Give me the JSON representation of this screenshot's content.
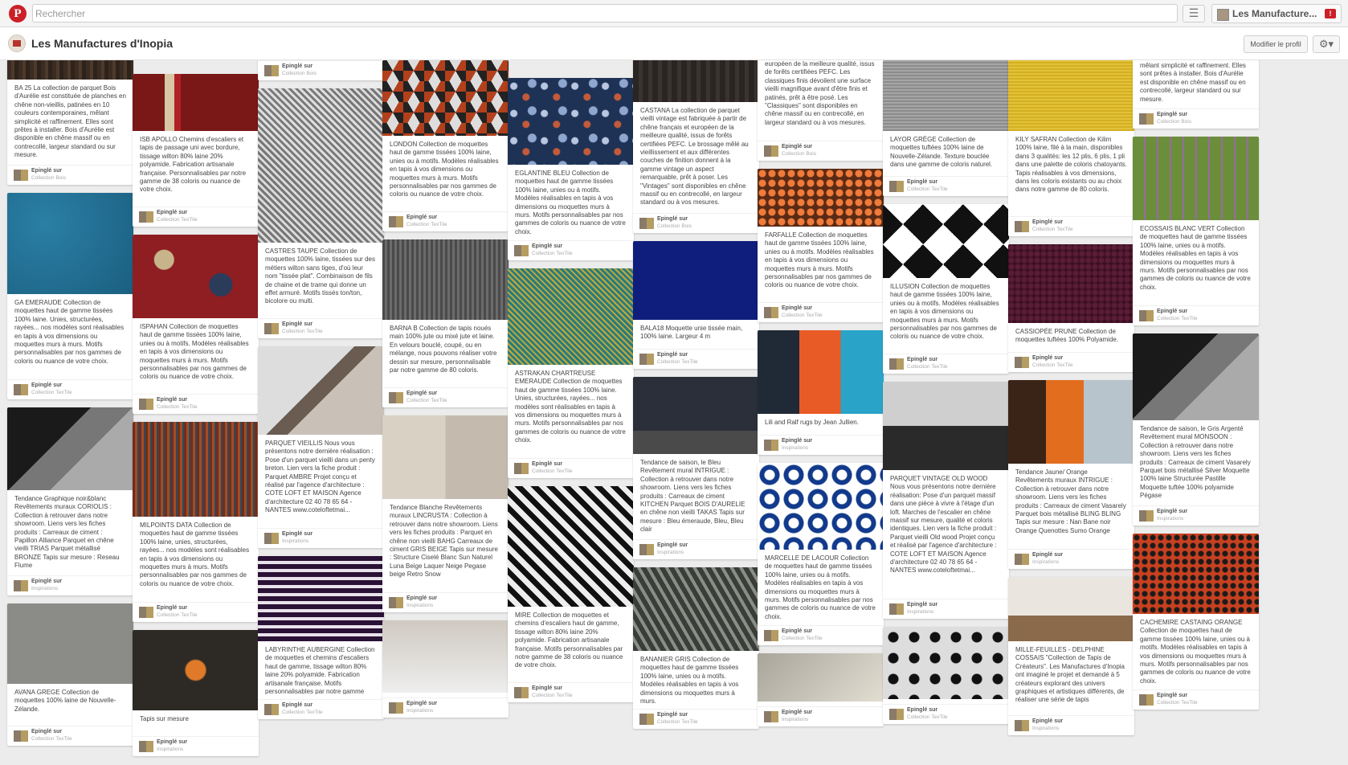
{
  "topbar": {
    "search_placeholder": "Rechercher",
    "logo_letter": "P",
    "user_name": "Les Manufacture...",
    "notif_badge": "!"
  },
  "profile": {
    "name": "Les Manufactures d'Inopia",
    "edit_button": "Modifier le profil"
  },
  "columns": [
    {
      "pins": [
        {
          "pattern": "p-wood",
          "img_h": 38,
          "desc": "BA 25 La collection de parquet Bois d'Aurélie est constituée de planches en chêne non-vieillis, patinées en 10 couleurs contemporaines, mêlant simplicité et raffinement. Elles sont prêtes à installer. Bois d'Aurélie est disponible en chêne massif ou en contrecollé, largeur standard ou sur mesure.",
          "desc_h": 94,
          "src1": "Epinglé sur",
          "src2": "Collection Bois"
        },
        {
          "pattern": "p-blue",
          "img_h": 126,
          "desc": "GA EMERAUDE Collection de moquettes haut de gamme tissées 100% laine. Unies, structurées, rayées... nos modèles sont réalisables en tapis à vos dimensions ou moquettes murs à murs. Motifs personnalisables par nos gammes de coloris ou nuance de votre choix.",
          "desc_h": 94,
          "src1": "Epinglé sur",
          "src2": "Collection TexTile"
        },
        {
          "pattern": "p-mood-black",
          "img_h": 103,
          "desc": "Tendance Graphique noir&blanc Revêtements muraux CORIOLIS : Collection à retrouver dans notre showroom. Liens vers les fiches produits : Carreaux de ciment : Papillon Alliance Parquet en chêne vieilli TRIAS Parquet métallisé BRONZE Tapis sur mesure : Reseau Flume",
          "desc_h": 94,
          "src1": "Epinglé sur",
          "src2": "Inspirations"
        },
        {
          "pattern": "p-greystone",
          "img_h": 100,
          "desc": "AVANA GREGE Collection de moquettes 100% laine de Nouvelle-Zélande.",
          "desc_h": 40,
          "src1": "Epinglé sur",
          "src2": "Collection TexTile"
        }
      ]
    },
    {
      "pins": [
        {
          "pattern": "p-red-stripe",
          "img_h": 71,
          "desc": "ISB APOLLO Chemins d'escaliers et tapis de passage uni avec bordure, tissage wilton 80% laine 20% polyamide. Fabrication artisanale française. Personnalisables par notre gamme de 38 coloris ou nuance de votre choix.",
          "desc_h": 82,
          "src1": "Epinglé sur",
          "src2": "Collection TexTile"
        },
        {
          "pattern": "p-paisley",
          "img_h": 104,
          "desc": "ISPAHAN Collection de moquettes haut de gamme tissées 100% laine, unies ou à motifs. Modèles réalisables en tapis à vos dimensions ou moquettes murs à murs. Motifs personnalisables par nos gammes de coloris ou nuance de votre choix.",
          "desc_h": 82,
          "src1": "Epinglé sur",
          "src2": "Collection TexTile"
        },
        {
          "pattern": "p-multistripe",
          "img_h": 118,
          "desc": "MILPOINTS DATA Collection de moquettes haut de gamme tissées 100% laine, unies, structurées, rayées... nos modèles sont réalisables en tapis à vos dimensions ou moquettes murs à murs. Motifs personnalisables par nos gammes de coloris ou nuance de votre choix.",
          "desc_h": 94,
          "src1": "Epinglé sur",
          "src2": "Collection TexTile"
        },
        {
          "pattern": "p-rug-orange",
          "img_h": 100,
          "desc": "Tapis sur mesure",
          "desc_h": 20,
          "src1": "Epinglé sur",
          "src2": "Inspirations"
        }
      ]
    },
    {
      "pins": [
        {
          "pattern": "p-beige",
          "img_h": 0,
          "desc": "",
          "desc_h": 0,
          "src1": "Epinglé sur",
          "src2": "Collection Bois"
        },
        {
          "pattern": "p-herring",
          "img_h": 192,
          "desc": "CASTRES TAUPE Collection de moquettes 100% laine, tissées sur des métiers wilton sans tiges, d'où leur nom \"tissée plat\". Combinaison de fils de chaine et de trame qui donne un effet armuré. Motifs tissés ton/ton, bicolore ou multi.",
          "desc_h": 82,
          "src1": "Epinglé sur",
          "src2": "Collection TexTile"
        },
        {
          "pattern": "p-stairs",
          "img_h": 110,
          "desc": "PARQUET VIEILLIS Nous vous présentons notre dernière réalisation : Pose d'un parquet vieilli dans un penty breton. Lien vers la fiche produit : Parquet AMBRE Projet conçu et réalisé par l'agence d'architecture : COTE LOFT ET MAISON Agence d'architecture 02 40 78 65 64 - NANTES www.coteloftetmai...",
          "desc_h": 104,
          "src1": "Epinglé sur",
          "src2": "Inspirations"
        },
        {
          "pattern": "p-greek",
          "img_h": 106,
          "desc": "LABYRINTHE AUBERGINE Collection de moquettes et chemins d'escaliers haut de gamme, tissage wilton 80% laine 20% polyamide. Fabrication artisanale française. Motifs personnalisables par notre gamme",
          "desc_h": 60,
          "src1": "Epinglé sur",
          "src2": "Collection TexTile"
        }
      ]
    },
    {
      "pins": [
        {
          "pattern": "p-cubes",
          "img_h": 94,
          "desc": "LONDON Collection de moquettes haut de gamme tissées 100% laine, unies ou à motifs. Modèles réalisables en tapis à vos dimensions ou moquettes murs à murs. Motifs personnalisables par nos gammes de coloris ou nuance de votre choix.",
          "desc_h": 82,
          "src1": "Epinglé sur",
          "src2": "Collection TexTile"
        },
        {
          "pattern": "p-grey-knit",
          "img_h": 100,
          "desc": "BARNA B Collection de tapis noués main 100% jute ou mixé jute et laine. En velours bouclé, coupé, ou en mélange, nous pouvons réaliser votre dessin sur mesure, personnalisable par notre gamme de 80 coloris.",
          "desc_h": 72,
          "src1": "Epinglé sur",
          "src2": "Collection TexTile"
        },
        {
          "pattern": "p-creamtiles",
          "img_h": 104,
          "desc": "Tendance Blanche Revêtements muraux LINCRUSTA : Collection à retrouver dans notre showroom. Liens vers les fiches produits : Parquet en chêne non vieilli BAHG Carreaux de ciment GRIS BEIGE Tapis sur mesure : Structure Ciselé Blanc Sun Naturel Luna Beige Laquer Neige Pegase beige Retro Snow",
          "desc_h": 104,
          "src1": "Epinglé sur",
          "src2": "Inspirations"
        },
        {
          "pattern": "p-bed",
          "img_h": 90,
          "desc": "",
          "desc_h": 0,
          "src1": "Epinglé sur",
          "src2": "Inspirations"
        }
      ]
    },
    {
      "pins": [
        {
          "pattern": "p-navyfloral",
          "img_h": 108,
          "desc": "EGLANTINE BLEU Collection de moquettes haut de gamme tissées 100% laine, unies ou à motifs. Modèles réalisables en tapis à vos dimensions ou moquettes murs à murs. Motifs personnalisables par nos gammes de coloris ou nuance de votre choix.",
          "desc_h": 82,
          "src1": "Epinglé sur",
          "src2": "Collection TexTile"
        },
        {
          "pattern": "p-teal-weave",
          "img_h": 120,
          "desc": "ASTRAKAN CHARTREUSE EMERAUDE Collection de moquettes haut de gamme tissées 100% laine. Unies, structurées, rayées... nos modèles sont réalisables en tapis à vos dimensions ou moquettes murs à murs. Motifs personnalisables par nos gammes de coloris ou nuance de votre choix.",
          "desc_h": 104,
          "src1": "Epinglé sur",
          "src2": "Collection TexTile"
        },
        {
          "pattern": "p-zigzag",
          "img_h": 150,
          "desc": "MIRE Collection de moquettes et chemins d'escaliers haut de gamme, tissage wilton 80% laine 20% polyamide. Fabrication artisanale française. Motifs personnalisables par notre gamme de 38 coloris ou nuance de votre choix.",
          "desc_h": 82,
          "src1": "Epinglé sur",
          "src2": "Collection TexTile"
        }
      ]
    },
    {
      "pins": [
        {
          "pattern": "p-darkwood",
          "img_h": 54,
          "desc": "CASTANA La collection de parquet vieilli vintage est fabriquée à partir de chêne français et européen de la meilleure qualité, issus de forêts certifiées PEFC. Le brossage mêlé au vieillissement et aux différentes couches de finition donnent à la gamme vintage un aspect remarquable, prêt à poser. Les \"Vintages\" sont disponibles en chêne massif ou en contrecollé, en largeur standard ou à vos mesures.",
          "desc_h": 126,
          "src1": "Epinglé sur",
          "src2": "Collection Bois"
        },
        {
          "pattern": "p-cobalt",
          "img_h": 98,
          "desc": "BALA18 Moquette unie tissée main, 100% laine. Largeur 4 m",
          "desc_h": 24,
          "src1": "Epinglé sur",
          "src2": "Collection TexTile"
        },
        {
          "pattern": "p-bluemood",
          "img_h": 96,
          "desc": "Tendance de saison, le Bleu Revêtement mural INTRIGUE : Collection à retrouver dans notre showroom. Liens vers les fiches produits : Carreaux de ciment KITCHEN Parquet BOIS D'AURELIE en chêne non vieilli TAKAS Tapis sur mesure : Bleu émeraude, Bleu, Bleu clair",
          "desc_h": 94,
          "src1": "Epinglé sur",
          "src2": "Inspirations"
        },
        {
          "pattern": "p-leaf",
          "img_h": 104,
          "desc": "BANANIER GRIS Collection de moquettes haut de gamme tissées 100% laine, unies ou à motifs. Modèles réalisables en tapis à vos dimensions ou moquettes murs à murs.",
          "desc_h": 60,
          "src1": "Epinglé sur",
          "src2": "Collection TexTile"
        }
      ]
    },
    {
      "pins": [
        {
          "pattern": "p-beige",
          "img_h": 0,
          "desc": "européen de la meilleure qualité, issus de forêts certifiées PEFC. Les classiques finis dévoilent une surface vieilli magnifique avant d'être finis et patinés, prêt à être posé. Les \"Classiques\" sont disponibles en chêne massif ou en contrecollé, en largeur standard ou à vos mesures.",
          "desc_h": 94,
          "src1": "Epinglé sur",
          "src2": "Collection Bois"
        },
        {
          "pattern": "p-orange-dots",
          "img_h": 72,
          "desc": "FARFALLE Collection de moquettes haut de gamme tissées 100% laine, unies ou à motifs. Modèles réalisables en tapis à vos dimensions ou moquettes murs à murs. Motifs personnalisables par nos gammes de coloris ou nuance de votre choix.",
          "desc_h": 82,
          "src1": "Epinglé sur",
          "src2": "Collection TexTile"
        },
        {
          "pattern": "p-lili",
          "img_h": 104,
          "desc": "Lili and Ralf rugs by Jean Jullien.",
          "desc_h": 14,
          "src1": "Epinglé sur",
          "src2": "Inspirations"
        },
        {
          "pattern": "p-blue-white",
          "img_h": 108,
          "desc": "MARCELLE DE LACOUR Collection de moquettes haut de gamme tissées 100% laine, unies ou à motifs. Modèles réalisables en tapis à vos dimensions ou moquettes murs à murs. Motifs personnalisables par nos gammes de coloris ou nuance de votre choix.",
          "desc_h": 82,
          "src1": "Epinglé sur",
          "src2": "Collection TexTile"
        },
        {
          "pattern": "p-gray-wall",
          "img_h": 60,
          "desc": "",
          "desc_h": 0,
          "src1": "Epinglé sur",
          "src2": "Inspirations"
        }
      ]
    },
    {
      "pins": [
        {
          "pattern": "p-grey-tweed",
          "img_h": 88,
          "desc": "LAYOR GRÈGE Collection de moquettes tuftées 100% laine de Nouvelle-Zélande. Texture bouclée dans une gamme de coloris naturel.",
          "desc_h": 44,
          "src1": "Epinglé sur",
          "src2": "Collection TexTile"
        },
        {
          "pattern": "p-geo-bw",
          "img_h": 92,
          "desc": "ILLUSION Collection de moquettes haut de gamme tissées 100% laine, unies ou à motifs. Modèles réalisables en tapis à vos dimensions ou moquettes murs à murs. Motifs personnalisables par nos gammes de coloris ou nuance de votre choix.",
          "desc_h": 82,
          "src1": "Epinglé sur",
          "src2": "Collection TexTile"
        },
        {
          "pattern": "p-interior",
          "img_h": 110,
          "desc": "PARQUET VINTAGE OLD WOOD Nous vous présentons notre dernière réalisation: Pose d'un parquet massif dans une pièce à vivre à l'étage d'un loft. Marches de l'escalier en chêne massif sur mesure, qualité et coloris identiques. Lien vers la fiche produit : Parquet vieilli Old wood Projet conçu et réalisé par l'agence d'architecture : COTE LOFT ET MAISON Agence d'architecture 02 40 78 65 64 - NANTES www.coteloftetmai...",
          "desc_h": 148,
          "src1": "Epinglé sur",
          "src2": "Inspirations"
        },
        {
          "pattern": "p-flowerrug",
          "img_h": 90,
          "desc": "",
          "desc_h": 0,
          "src1": "Epinglé sur",
          "src2": "Collection TexTile"
        }
      ]
    },
    {
      "pins": [
        {
          "pattern": "p-yellow",
          "img_h": 88,
          "desc": "KILY SAFRAN Collection de Kilim 100% laine, filé à la main, disponibles dans 3 qualités: les 12 plis, 6 plis, 1 pli dans une palette de coloris chatoyants. Tapis réalisables à vos dimensions, dans les coloris existants ou au choix dans notre gamme de 80 coloris.",
          "desc_h": 94,
          "src1": "Epinglé sur",
          "src2": "Collection TexTile"
        },
        {
          "pattern": "p-purple",
          "img_h": 98,
          "desc": "CASSIOPÉE PRUNE Collection de moquettes tuftées 100% Polyamide.",
          "desc_h": 24,
          "src1": "Epinglé sur",
          "src2": "Collection TexTile"
        },
        {
          "pattern": "p-orange-mood",
          "img_h": 104,
          "desc": "Tendance Jaune/ Orange Revêtements muraux INTRIGUE : Collection à retrouver dans notre showroom. Liens vers les fiches produits : Carreaux de ciment Vasarely Parquet bois métallisé BLING BLING Tapis sur mesure : Nan Bane noir Orange Quenottes Sumo Orange",
          "desc_h": 94,
          "src1": "Epinglé sur",
          "src2": "Inspirations"
        },
        {
          "pattern": "p-room",
          "img_h": 80,
          "desc": "MILLE-FEUILLES - DELPHINE COSSAIS \"Collection de Tapis de Créateurs\". Les Manufactures d'Inopia ont imaginé le projet et demandé à 5 créateurs explorant des univers graphiques et artistiques différents, de réaliser une série de tapis",
          "desc_h": 80,
          "src1": "Epinglé sur",
          "src2": "Inspirations"
        }
      ]
    },
    {
      "pins": [
        {
          "pattern": "p-beige",
          "img_h": 0,
          "desc": "mêlant simplicité et raffinement. Elles sont prêtes à installer. Bois d'Aurélie est disponible en chêne massif ou en contrecollé, largeur standard ou sur mesure.",
          "desc_h": 52,
          "src1": "Epinglé sur",
          "src2": "Collection Bois"
        },
        {
          "pattern": "p-green-plaid",
          "img_h": 104,
          "desc": "ECOSSAIS BLANC VERT Collection de moquettes haut de gamme tissées 100% laine, unies ou à motifs. Modèles réalisables en tapis à vos dimensions ou moquettes murs à murs. Motifs personnalisables par nos gammes de coloris ou nuance de votre choix.",
          "desc_h": 94,
          "src1": "Epinglé sur",
          "src2": "Collection TexTile"
        },
        {
          "pattern": "p-mood-black",
          "img_h": 108,
          "desc": "Tendance de saison, le Gris Argenté Revêtement mural MONSOON : Collection à retrouver dans notre showroom. Liens vers les fiches produits : Carreaux de ciment Vasarely Parquet bois métallisé Silver Moquette 100% laine Structurée Pastille Moquette tuftée 100% polyamide Pégase",
          "desc_h": 94,
          "src1": "Epinglé sur",
          "src2": "Inspirations"
        },
        {
          "pattern": "p-orange-lace",
          "img_h": 100,
          "desc": "CACHEMIRE CASTAING ORANGE Collection de moquettes haut de gamme tissées 100% laine, unies ou à motifs. Modèles réalisables en tapis à vos dimensions ou moquettes murs à murs. Motifs personnalisables par nos gammes de coloris ou nuance de votre choix.",
          "desc_h": 82,
          "src1": "Epinglé sur",
          "src2": "Collection TexTile"
        }
      ]
    }
  ]
}
